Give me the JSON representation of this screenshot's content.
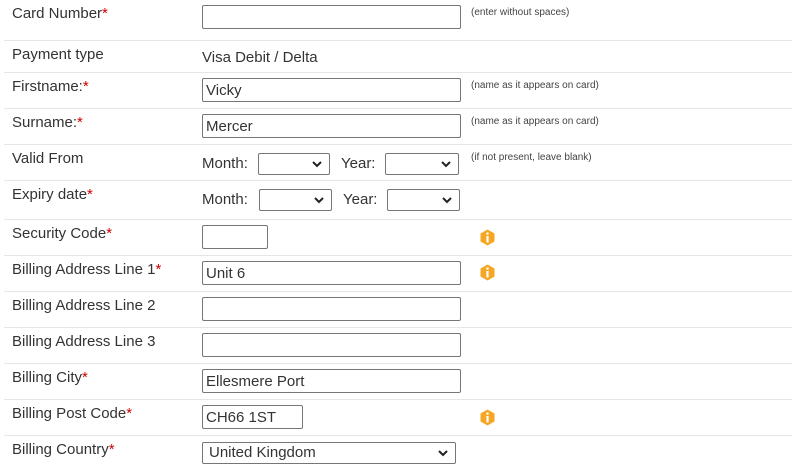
{
  "form": {
    "card_number": {
      "label": "Card Number",
      "value": "",
      "hint": "(enter without spaces)"
    },
    "payment_type": {
      "label": "Payment type",
      "value": "Visa Debit / Delta"
    },
    "firstname": {
      "label": "Firstname:",
      "value": "Vicky",
      "hint": "(name as it appears on card)"
    },
    "surname": {
      "label": "Surname:",
      "value": "Mercer",
      "hint": "(name as it appears on card)"
    },
    "valid_from": {
      "label": "Valid From",
      "month_label": "Month:",
      "year_label": "Year:",
      "month_value": "",
      "year_value": "",
      "hint": "(if not present, leave blank)"
    },
    "expiry_date": {
      "label": "Expiry date",
      "month_label": "Month:",
      "year_label": "Year:",
      "month_value": "",
      "year_value": ""
    },
    "security_code": {
      "label": "Security Code",
      "value": "",
      "icon": "info-icon"
    },
    "billing_address_1": {
      "label": "Billing Address Line 1",
      "value": "Unit 6",
      "icon": "info-icon"
    },
    "billing_address_2": {
      "label": "Billing Address Line 2",
      "value": ""
    },
    "billing_address_3": {
      "label": "Billing Address Line 3",
      "value": ""
    },
    "billing_city": {
      "label": "Billing City",
      "value": "Ellesmere Port"
    },
    "billing_post_code": {
      "label": "Billing Post Code",
      "value": "CH66 1ST",
      "icon": "info-icon"
    },
    "billing_country": {
      "label": "Billing Country",
      "value": "United Kingdom"
    }
  },
  "required_marker": "*",
  "colors": {
    "required": "#cc0000",
    "info_icon": "#f5a623",
    "row_border": "#e6e6e6"
  }
}
